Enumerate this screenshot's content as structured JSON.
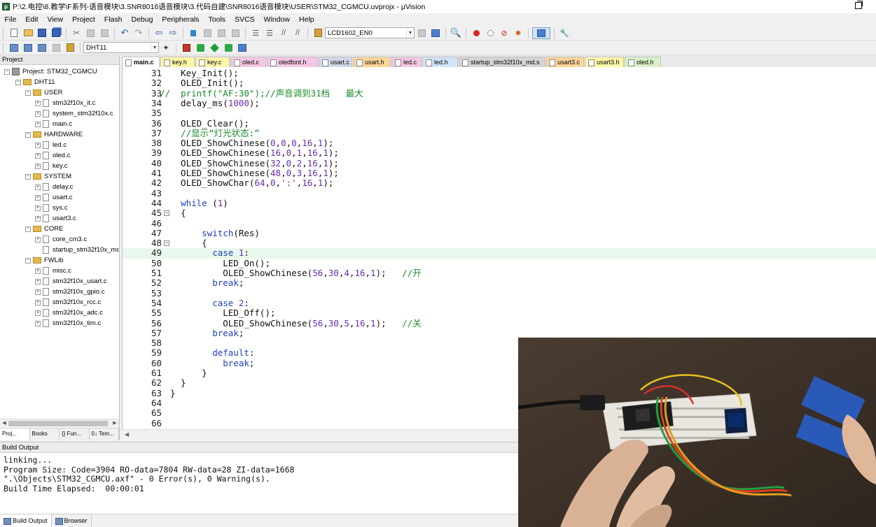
{
  "window": {
    "title": "P:\\2.电控\\8.教学\\F系列-语音模块\\3.SNR8016语音模块\\3.代码自建\\SNR8016语音模块\\USER\\STM32_CGMCU.uvprojx - µVision",
    "app_icon": "keil-uvision-icon"
  },
  "menu": [
    "File",
    "Edit",
    "View",
    "Project",
    "Flash",
    "Debug",
    "Peripherals",
    "Tools",
    "SVCS",
    "Window",
    "Help"
  ],
  "toolbar": {
    "target_combo": "LCD1602_EN0",
    "target_select": "DHT11"
  },
  "project_panel": {
    "header": "Project",
    "tree": [
      {
        "label": "Project: STM32_CGMCU",
        "level": 0,
        "type": "project",
        "expander": "−"
      },
      {
        "label": "DHT11",
        "level": 1,
        "type": "folder",
        "expander": "−"
      },
      {
        "label": "USER",
        "level": 2,
        "type": "folder",
        "expander": "−"
      },
      {
        "label": "stm32f10x_it.c",
        "level": 3,
        "type": "file",
        "expander": "+"
      },
      {
        "label": "system_stm32f10x.c",
        "level": 3,
        "type": "file",
        "expander": "+"
      },
      {
        "label": "main.c",
        "level": 3,
        "type": "file",
        "expander": "+"
      },
      {
        "label": "HARDWARE",
        "level": 2,
        "type": "folder",
        "expander": "−"
      },
      {
        "label": "led.c",
        "level": 3,
        "type": "file",
        "expander": "+"
      },
      {
        "label": "oled.c",
        "level": 3,
        "type": "file",
        "expander": "+"
      },
      {
        "label": "key.c",
        "level": 3,
        "type": "file",
        "expander": "+"
      },
      {
        "label": "SYSTEM",
        "level": 2,
        "type": "folder",
        "expander": "−"
      },
      {
        "label": "delay.c",
        "level": 3,
        "type": "file",
        "expander": "+"
      },
      {
        "label": "usart.c",
        "level": 3,
        "type": "file",
        "expander": "+"
      },
      {
        "label": "sys.c",
        "level": 3,
        "type": "file",
        "expander": "+"
      },
      {
        "label": "usart3.c",
        "level": 3,
        "type": "file",
        "expander": "+"
      },
      {
        "label": "CORE",
        "level": 2,
        "type": "folder",
        "expander": "−"
      },
      {
        "label": "core_cm3.c",
        "level": 3,
        "type": "file",
        "expander": "+"
      },
      {
        "label": "startup_stm32f10x_md",
        "level": 3,
        "type": "file",
        "expander": ""
      },
      {
        "label": "FWLib",
        "level": 2,
        "type": "folder",
        "expander": "−"
      },
      {
        "label": "misc.c",
        "level": 3,
        "type": "file",
        "expander": "+"
      },
      {
        "label": "stm32f10x_usart.c",
        "level": 3,
        "type": "file",
        "expander": "+"
      },
      {
        "label": "stm32f10x_gpio.c",
        "level": 3,
        "type": "file",
        "expander": "+"
      },
      {
        "label": "stm32f10x_rcc.c",
        "level": 3,
        "type": "file",
        "expander": "+"
      },
      {
        "label": "stm32f10x_adc.c",
        "level": 3,
        "type": "file",
        "expander": "+"
      },
      {
        "label": "stm32f10x_tim.c",
        "level": 3,
        "type": "file",
        "expander": "+"
      }
    ],
    "tabs": [
      "Proj...",
      "Books",
      "{} Fun...",
      "0↓ Tem..."
    ]
  },
  "editor": {
    "tabs": [
      {
        "label": "main.c",
        "color": "#ffffff",
        "active": true
      },
      {
        "label": "key.h",
        "color": "#fff7a8"
      },
      {
        "label": "key.c",
        "color": "#fff7a8"
      },
      {
        "label": "oled.c",
        "color": "#f4c7e6"
      },
      {
        "label": "oledfont.h",
        "color": "#f4c7e6"
      },
      {
        "label": "usart.c",
        "color": "#d0d8e8"
      },
      {
        "label": "usart.h",
        "color": "#ffd49a"
      },
      {
        "label": "led.c",
        "color": "#f4c7e6"
      },
      {
        "label": "led.h",
        "color": "#cfe4f7"
      },
      {
        "label": "startup_stm32f10x_md.s",
        "color": "#d4d4d4"
      },
      {
        "label": "usart3.c",
        "color": "#ffd49a"
      },
      {
        "label": "usart3.h",
        "color": "#fff7a8"
      },
      {
        "label": "oled.h",
        "color": "#d8f0c8"
      }
    ],
    "highlight_line": 49,
    "lines": [
      {
        "n": "31",
        "code": "  Key_Init();"
      },
      {
        "n": "32",
        "code": "  OLED_Init();"
      },
      {
        "n": "33",
        "code": "//  printf(\"AF:30\");//声音调到31档   最大",
        "shift": -15
      },
      {
        "n": "34",
        "code": "  delay_ms(1000);"
      },
      {
        "n": "35",
        "code": ""
      },
      {
        "n": "36",
        "code": "  OLED_Clear();"
      },
      {
        "n": "37",
        "code": "  //显示“灯光状态:”"
      },
      {
        "n": "38",
        "code": "  OLED_ShowChinese(0,0,0,16,1);"
      },
      {
        "n": "39",
        "code": "  OLED_ShowChinese(16,0,1,16,1);"
      },
      {
        "n": "40",
        "code": "  OLED_ShowChinese(32,0,2,16,1);"
      },
      {
        "n": "41",
        "code": "  OLED_ShowChinese(48,0,3,16,1);"
      },
      {
        "n": "42",
        "code": "  OLED_ShowChar(64,0,':',16,1);"
      },
      {
        "n": "43",
        "code": ""
      },
      {
        "n": "44",
        "code": "  while (1)"
      },
      {
        "n": "45",
        "code": "  {",
        "fold": "−"
      },
      {
        "n": "46",
        "code": ""
      },
      {
        "n": "47",
        "code": "      switch(Res)"
      },
      {
        "n": "48",
        "code": "      {",
        "fold": "−"
      },
      {
        "n": "49",
        "code": "        case 1:"
      },
      {
        "n": "50",
        "code": "          LED_On();"
      },
      {
        "n": "51",
        "code": "          OLED_ShowChinese(56,30,4,16,1);   //开"
      },
      {
        "n": "52",
        "code": "        break;"
      },
      {
        "n": "53",
        "code": ""
      },
      {
        "n": "54",
        "code": "        case 2:"
      },
      {
        "n": "55",
        "code": "          LED_Off();"
      },
      {
        "n": "56",
        "code": "          OLED_ShowChinese(56,30,5,16,1);   //关"
      },
      {
        "n": "57",
        "code": "        break;"
      },
      {
        "n": "58",
        "code": ""
      },
      {
        "n": "59",
        "code": "        default:"
      },
      {
        "n": "60",
        "code": "          break;"
      },
      {
        "n": "61",
        "code": "      }"
      },
      {
        "n": "62",
        "code": "  }"
      },
      {
        "n": "63",
        "code": "}"
      },
      {
        "n": "64",
        "code": ""
      },
      {
        "n": "65",
        "code": ""
      },
      {
        "n": "66",
        "code": ""
      }
    ]
  },
  "build_output": {
    "header": "Build Output",
    "lines": [
      "linking...",
      "Program Size: Code=3904 RO-data=7804 RW-data=28 ZI-data=1668",
      "\".\\Objects\\STM32_CGMCU.axf\" - 0 Error(s), 0 Warning(s).",
      "Build Time Elapsed:  00:00:01"
    ],
    "tabs": [
      "Build Output",
      "Browser"
    ]
  },
  "syntax_colors": {
    "keyword": "#1f3fbf",
    "comment": "#1a8a2a",
    "number": "#6a2cb0",
    "string": "#8b1a8b"
  }
}
